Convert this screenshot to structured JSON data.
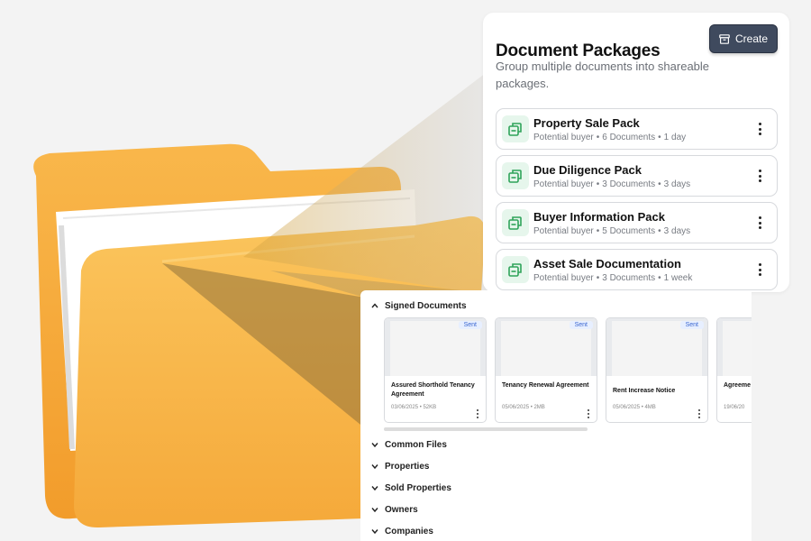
{
  "packages": {
    "title": "Document Packages",
    "subtitle": "Group multiple documents into shareable packages.",
    "create_label": "Create",
    "items": [
      {
        "name": "Property Sale Pack",
        "audience": "Potential buyer",
        "docs": "6 Documents",
        "age": "1 day"
      },
      {
        "name": "Due Diligence Pack",
        "audience": "Potential buyer",
        "docs": "3 Documents",
        "age": "3 days"
      },
      {
        "name": "Buyer Information Pack",
        "audience": "Potential buyer",
        "docs": "5 Documents",
        "age": "3 days"
      },
      {
        "name": "Asset Sale Documentation",
        "audience": "Potential buyer",
        "docs": "3 Documents",
        "age": "1 week"
      }
    ]
  },
  "documents": {
    "section_open": "Signed Documents",
    "cards": [
      {
        "title": "Assured Shorthold Tenancy Agreement",
        "meta": "03/06/2025 • 52KB",
        "badge": "Sent"
      },
      {
        "title": "Tenancy Renewal Agreement",
        "meta": "05/06/2025 • 2MB",
        "badge": "Sent"
      },
      {
        "title": "Rent Increase Notice",
        "meta": "05/06/2025 • 4MB",
        "badge": "Sent"
      },
      {
        "title": "Agreeme",
        "meta": "19/06/20",
        "badge": ""
      }
    ],
    "collapsed_sections": [
      "Common Files",
      "Properties",
      "Sold Properties",
      "Owners",
      "Companies"
    ]
  },
  "colors": {
    "accent_button": "#3f4a5e",
    "icon_green": "#2fa35a",
    "badge_blue": "#3a66d0",
    "folder_orange": "#f7b23e"
  },
  "icons": {
    "create": "archive-icon",
    "package": "package-docs-icon",
    "menu": "kebab-menu-icon",
    "expand": "chevron-up-icon",
    "collapse": "chevron-down-icon"
  }
}
